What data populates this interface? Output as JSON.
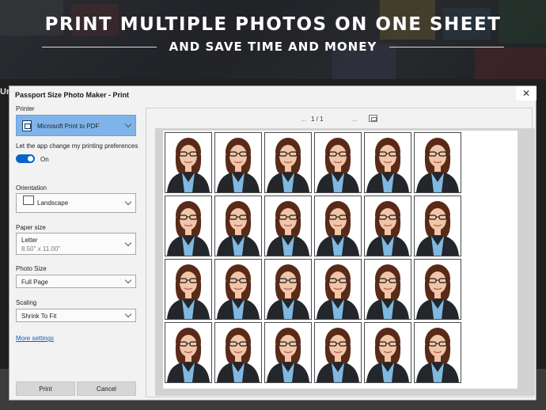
{
  "banner": {
    "headline": "PRINT MULTIPLE PHOTOS ON ONE SHEET",
    "subline": "AND SAVE TIME AND MONEY"
  },
  "app_strip": {
    "title_fragment": "Un"
  },
  "dialog": {
    "title": "Passport Size Photo Maker - Print",
    "close_glyph": "✕",
    "printer": {
      "label": "Printer",
      "value": "Microsoft Print to PDF"
    },
    "preferences": {
      "label": "Let the app change my printing preferences",
      "toggle_state": "On"
    },
    "orientation": {
      "label": "Orientation",
      "value": "Landscape"
    },
    "paper_size": {
      "label": "Paper size",
      "value": "Letter",
      "dimensions": "8.50\" x 11.00\""
    },
    "photo_size": {
      "label": "Photo Size",
      "value": "Full Page"
    },
    "scaling": {
      "label": "Scaling",
      "value": "Shrink To Fit"
    },
    "more_settings": "More settings",
    "print_label": "Print",
    "cancel_label": "Cancel"
  },
  "preview": {
    "prev_glyph": "←",
    "next_glyph": "→",
    "page_indicator": "1 / 1",
    "grid": {
      "rows": 4,
      "cols": 6
    }
  },
  "colors": {
    "accent": "#0a64c8",
    "printer_select_bg": "#7eb4ea",
    "link": "#1a5fb4",
    "suit": "#23262b",
    "shirt": "#7fb8e0",
    "hair": "#5a2a18",
    "skin": "#f1c5a8"
  },
  "icons": {
    "printer": "printer-icon",
    "close": "close-icon",
    "fit_page": "fit-page-icon",
    "chevron": "chevron-down-icon"
  }
}
